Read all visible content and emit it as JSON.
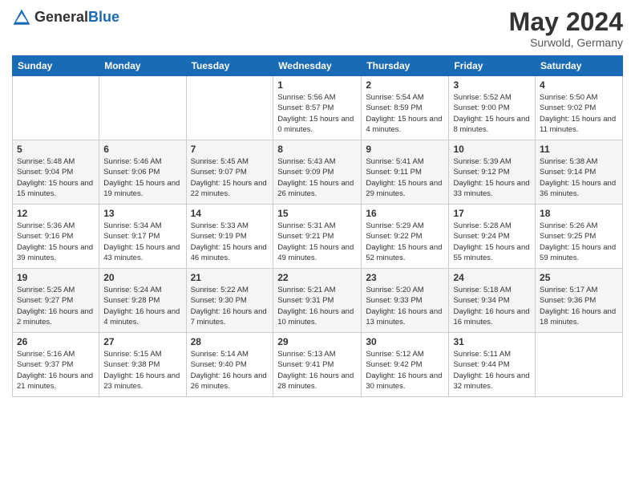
{
  "logo": {
    "general": "General",
    "blue": "Blue"
  },
  "title": {
    "month_year": "May 2024",
    "location": "Surwold, Germany"
  },
  "days_of_week": [
    "Sunday",
    "Monday",
    "Tuesday",
    "Wednesday",
    "Thursday",
    "Friday",
    "Saturday"
  ],
  "weeks": [
    [
      {
        "day": "",
        "info": ""
      },
      {
        "day": "",
        "info": ""
      },
      {
        "day": "",
        "info": ""
      },
      {
        "day": "1",
        "info": "Sunrise: 5:56 AM\nSunset: 8:57 PM\nDaylight: 15 hours\nand 0 minutes."
      },
      {
        "day": "2",
        "info": "Sunrise: 5:54 AM\nSunset: 8:59 PM\nDaylight: 15 hours\nand 4 minutes."
      },
      {
        "day": "3",
        "info": "Sunrise: 5:52 AM\nSunset: 9:00 PM\nDaylight: 15 hours\nand 8 minutes."
      },
      {
        "day": "4",
        "info": "Sunrise: 5:50 AM\nSunset: 9:02 PM\nDaylight: 15 hours\nand 11 minutes."
      }
    ],
    [
      {
        "day": "5",
        "info": "Sunrise: 5:48 AM\nSunset: 9:04 PM\nDaylight: 15 hours\nand 15 minutes."
      },
      {
        "day": "6",
        "info": "Sunrise: 5:46 AM\nSunset: 9:06 PM\nDaylight: 15 hours\nand 19 minutes."
      },
      {
        "day": "7",
        "info": "Sunrise: 5:45 AM\nSunset: 9:07 PM\nDaylight: 15 hours\nand 22 minutes."
      },
      {
        "day": "8",
        "info": "Sunrise: 5:43 AM\nSunset: 9:09 PM\nDaylight: 15 hours\nand 26 minutes."
      },
      {
        "day": "9",
        "info": "Sunrise: 5:41 AM\nSunset: 9:11 PM\nDaylight: 15 hours\nand 29 minutes."
      },
      {
        "day": "10",
        "info": "Sunrise: 5:39 AM\nSunset: 9:12 PM\nDaylight: 15 hours\nand 33 minutes."
      },
      {
        "day": "11",
        "info": "Sunrise: 5:38 AM\nSunset: 9:14 PM\nDaylight: 15 hours\nand 36 minutes."
      }
    ],
    [
      {
        "day": "12",
        "info": "Sunrise: 5:36 AM\nSunset: 9:16 PM\nDaylight: 15 hours\nand 39 minutes."
      },
      {
        "day": "13",
        "info": "Sunrise: 5:34 AM\nSunset: 9:17 PM\nDaylight: 15 hours\nand 43 minutes."
      },
      {
        "day": "14",
        "info": "Sunrise: 5:33 AM\nSunset: 9:19 PM\nDaylight: 15 hours\nand 46 minutes."
      },
      {
        "day": "15",
        "info": "Sunrise: 5:31 AM\nSunset: 9:21 PM\nDaylight: 15 hours\nand 49 minutes."
      },
      {
        "day": "16",
        "info": "Sunrise: 5:29 AM\nSunset: 9:22 PM\nDaylight: 15 hours\nand 52 minutes."
      },
      {
        "day": "17",
        "info": "Sunrise: 5:28 AM\nSunset: 9:24 PM\nDaylight: 15 hours\nand 55 minutes."
      },
      {
        "day": "18",
        "info": "Sunrise: 5:26 AM\nSunset: 9:25 PM\nDaylight: 15 hours\nand 59 minutes."
      }
    ],
    [
      {
        "day": "19",
        "info": "Sunrise: 5:25 AM\nSunset: 9:27 PM\nDaylight: 16 hours\nand 2 minutes."
      },
      {
        "day": "20",
        "info": "Sunrise: 5:24 AM\nSunset: 9:28 PM\nDaylight: 16 hours\nand 4 minutes."
      },
      {
        "day": "21",
        "info": "Sunrise: 5:22 AM\nSunset: 9:30 PM\nDaylight: 16 hours\nand 7 minutes."
      },
      {
        "day": "22",
        "info": "Sunrise: 5:21 AM\nSunset: 9:31 PM\nDaylight: 16 hours\nand 10 minutes."
      },
      {
        "day": "23",
        "info": "Sunrise: 5:20 AM\nSunset: 9:33 PM\nDaylight: 16 hours\nand 13 minutes."
      },
      {
        "day": "24",
        "info": "Sunrise: 5:18 AM\nSunset: 9:34 PM\nDaylight: 16 hours\nand 16 minutes."
      },
      {
        "day": "25",
        "info": "Sunrise: 5:17 AM\nSunset: 9:36 PM\nDaylight: 16 hours\nand 18 minutes."
      }
    ],
    [
      {
        "day": "26",
        "info": "Sunrise: 5:16 AM\nSunset: 9:37 PM\nDaylight: 16 hours\nand 21 minutes."
      },
      {
        "day": "27",
        "info": "Sunrise: 5:15 AM\nSunset: 9:38 PM\nDaylight: 16 hours\nand 23 minutes."
      },
      {
        "day": "28",
        "info": "Sunrise: 5:14 AM\nSunset: 9:40 PM\nDaylight: 16 hours\nand 26 minutes."
      },
      {
        "day": "29",
        "info": "Sunrise: 5:13 AM\nSunset: 9:41 PM\nDaylight: 16 hours\nand 28 minutes."
      },
      {
        "day": "30",
        "info": "Sunrise: 5:12 AM\nSunset: 9:42 PM\nDaylight: 16 hours\nand 30 minutes."
      },
      {
        "day": "31",
        "info": "Sunrise: 5:11 AM\nSunset: 9:44 PM\nDaylight: 16 hours\nand 32 minutes."
      },
      {
        "day": "",
        "info": ""
      }
    ]
  ]
}
